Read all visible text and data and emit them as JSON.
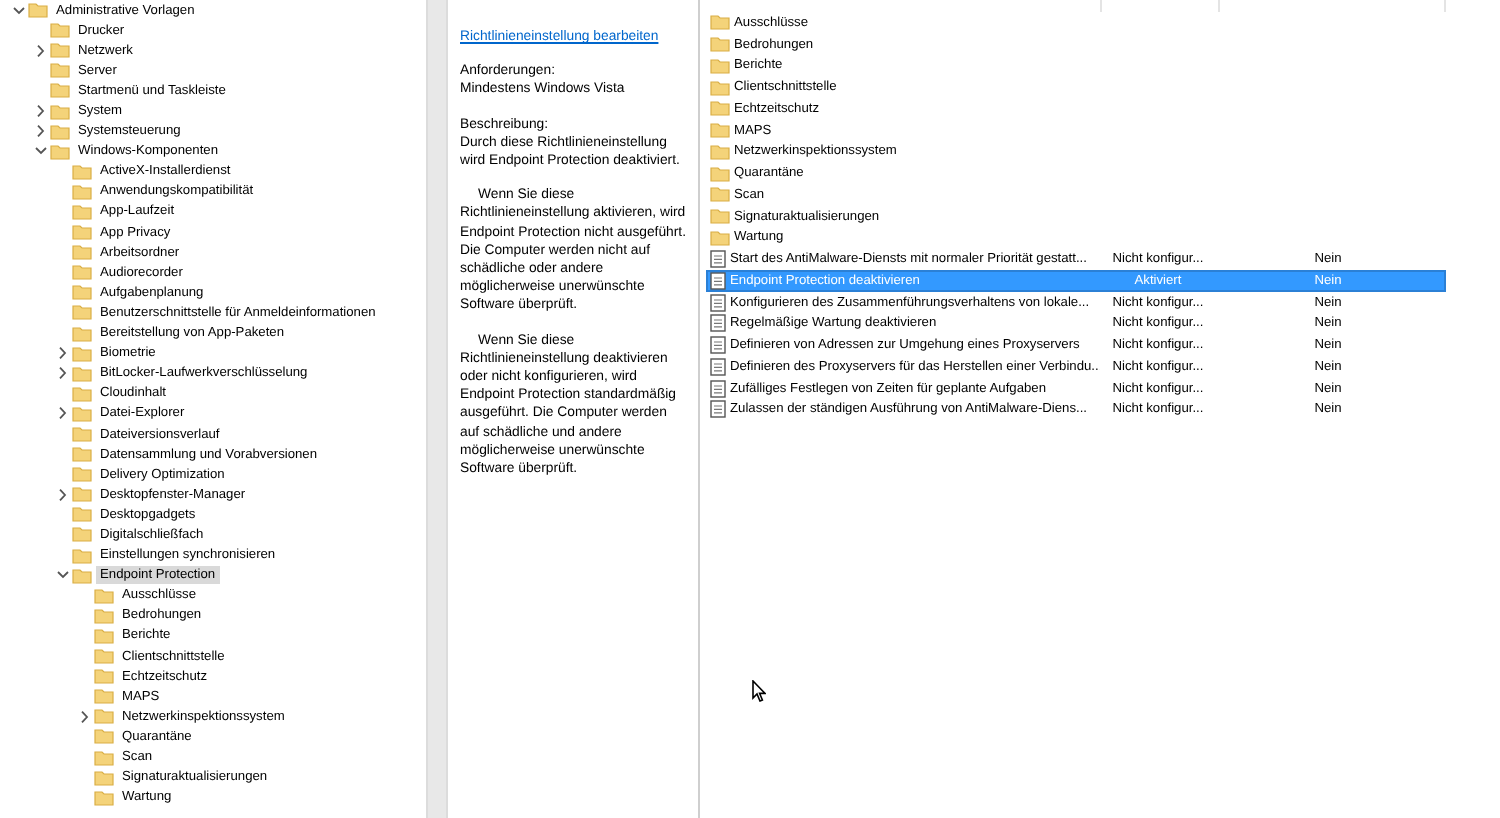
{
  "tree": [
    {
      "label": "Administrative Vorlagen",
      "selected": false,
      "expanded": true,
      "children": [
        {
          "label": "Drucker",
          "selected": false
        },
        {
          "label": "Netzwerk",
          "selected": false,
          "expanded": false
        },
        {
          "label": "Server",
          "selected": false
        },
        {
          "label": "Startmenü und Taskleiste",
          "selected": false
        },
        {
          "label": "System",
          "selected": false,
          "expanded": false
        },
        {
          "label": "Systemsteuerung",
          "selected": false,
          "expanded": false
        },
        {
          "label": "Windows-Komponenten",
          "selected": false,
          "expanded": true,
          "children": [
            {
              "label": "ActiveX-Installerdienst",
              "selected": false
            },
            {
              "label": "Anwendungskompatibilität",
              "selected": false
            },
            {
              "label": "App-Laufzeit",
              "selected": false
            },
            {
              "label": "App Privacy",
              "selected": false
            },
            {
              "label": "Arbeitsordner",
              "selected": false
            },
            {
              "label": "Audiorecorder",
              "selected": false
            },
            {
              "label": "Aufgabenplanung",
              "selected": false
            },
            {
              "label": "Benutzerschnittstelle für Anmeldeinformationen",
              "selected": false
            },
            {
              "label": "Bereitstellung von App-Paketen",
              "selected": false
            },
            {
              "label": "Biometrie",
              "selected": false,
              "expanded": false
            },
            {
              "label": "BitLocker-Laufwerkverschlüsselung",
              "selected": false,
              "expanded": false
            },
            {
              "label": "Cloudinhalt",
              "selected": false
            },
            {
              "label": "Datei-Explorer",
              "selected": false,
              "expanded": false
            },
            {
              "label": "Dateiversionsverlauf",
              "selected": false
            },
            {
              "label": "Datensammlung und Vorabversionen",
              "selected": false
            },
            {
              "label": "Delivery Optimization",
              "selected": false
            },
            {
              "label": "Desktopfenster-Manager",
              "selected": false,
              "expanded": false
            },
            {
              "label": "Desktopgadgets",
              "selected": false
            },
            {
              "label": "Digitalschließfach",
              "selected": false
            },
            {
              "label": "Einstellungen synchronisieren",
              "selected": false
            },
            {
              "label": "Endpoint Protection",
              "selected": true,
              "expanded": true,
              "children": [
                {
                  "label": "Ausschlüsse",
                  "selected": false
                },
                {
                  "label": "Bedrohungen",
                  "selected": false
                },
                {
                  "label": "Berichte",
                  "selected": false
                },
                {
                  "label": "Clientschnittstelle",
                  "selected": false
                },
                {
                  "label": "Echtzeitschutz",
                  "selected": false
                },
                {
                  "label": "MAPS",
                  "selected": false
                },
                {
                  "label": "Netzwerkinspektionssystem",
                  "selected": false,
                  "expanded": false
                },
                {
                  "label": "Quarantäne",
                  "selected": false
                },
                {
                  "label": "Scan",
                  "selected": false
                },
                {
                  "label": "Signaturaktualisierungen",
                  "selected": false
                },
                {
                  "label": "Wartung",
                  "selected": false
                }
              ]
            }
          ]
        }
      ]
    }
  ],
  "details": {
    "link": "Richtlinieneinstellung bearbeiten",
    "requirements_label": "Anforderungen:",
    "requirements": "Mindestens Windows Vista",
    "description_label": "Beschreibung:",
    "paragraphs": [
      "Durch diese Richtlinieneinstellung wird Endpoint Protection deaktiviert.",
      "Wenn Sie diese Richtlinieneinstellung aktivieren, wird Endpoint Protection nicht ausgeführt. Die Computer werden nicht auf schädliche oder andere möglicherweise unerwünschte Software überprüft.",
      "Wenn Sie diese Richtlinieneinstellung deaktivieren oder nicht konfigurieren, wird Endpoint Protection standardmäßig ausgeführt. Die Computer werden auf schädliche und andere möglicherweise unerwünschte Software überprüft."
    ]
  },
  "list": [
    {
      "kind": "folder",
      "name": "Ausschlüsse",
      "selected": false
    },
    {
      "kind": "folder",
      "name": "Bedrohungen",
      "selected": false
    },
    {
      "kind": "folder",
      "name": "Berichte",
      "selected": false
    },
    {
      "kind": "folder",
      "name": "Clientschnittstelle",
      "selected": false
    },
    {
      "kind": "folder",
      "name": "Echtzeitschutz",
      "selected": false
    },
    {
      "kind": "folder",
      "name": "MAPS",
      "selected": false
    },
    {
      "kind": "folder",
      "name": "Netzwerkinspektionssystem",
      "selected": false
    },
    {
      "kind": "folder",
      "name": "Quarantäne",
      "selected": false
    },
    {
      "kind": "folder",
      "name": "Scan",
      "selected": false
    },
    {
      "kind": "folder",
      "name": "Signaturaktualisierungen",
      "selected": false
    },
    {
      "kind": "folder",
      "name": "Wartung",
      "selected": false
    },
    {
      "kind": "setting",
      "name": "Start des AntiMalware-Diensts mit normaler Priorität gestatt...",
      "status": "Nicht konfigur...",
      "comment": "Nein",
      "selected": false
    },
    {
      "kind": "setting",
      "name": "Endpoint Protection deaktivieren",
      "status": "Aktiviert",
      "comment": "Nein",
      "selected": true
    },
    {
      "kind": "setting",
      "name": "Konfigurieren des Zusammenführungsverhaltens von lokale...",
      "status": "Nicht konfigur...",
      "comment": "Nein",
      "selected": false
    },
    {
      "kind": "setting",
      "name": "Regelmäßige Wartung deaktivieren",
      "status": "Nicht konfigur...",
      "comment": "Nein",
      "selected": false
    },
    {
      "kind": "setting",
      "name": "Definieren von Adressen zur Umgehung eines Proxyservers",
      "status": "Nicht konfigur...",
      "comment": "Nein",
      "selected": false
    },
    {
      "kind": "setting",
      "name": "Definieren des Proxyservers für das Herstellen einer Verbindu...",
      "status": "Nicht konfigur...",
      "comment": "Nein",
      "selected": false
    },
    {
      "kind": "setting",
      "name": "Zufälliges Festlegen von Zeiten für geplante Aufgaben",
      "status": "Nicht konfigur...",
      "comment": "Nein",
      "selected": false
    },
    {
      "kind": "setting",
      "name": "Zulassen der ständigen Ausführung von AntiMalware-Diens...",
      "status": "Nicht konfigur...",
      "comment": "Nein",
      "selected": false
    }
  ]
}
